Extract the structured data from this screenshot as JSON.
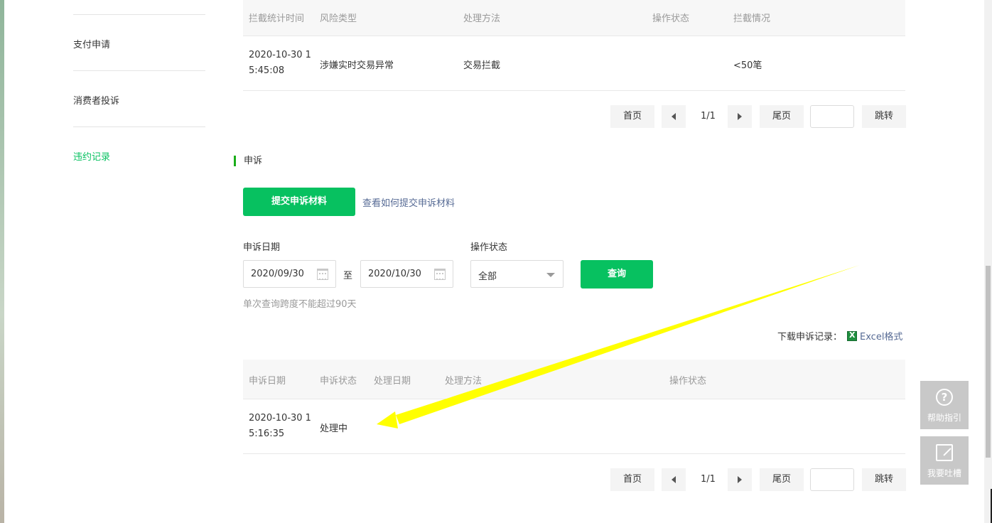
{
  "sidebar": {
    "items": [
      {
        "label": "支付申请"
      },
      {
        "label": "消费者投诉"
      },
      {
        "label": "违约记录",
        "active": true
      }
    ],
    "active_color": "#07c160"
  },
  "intercept_table": {
    "headers": [
      "拦截统计时间",
      "风险类型",
      "处理方法",
      "操作状态",
      "拦截情况"
    ],
    "rows": [
      {
        "time_line1": "2020-10-30 1",
        "time_line2": "5:45:08",
        "risk": "涉嫌实时交易异常",
        "method": "交易拦截",
        "status": "",
        "situation": "<50笔"
      }
    ]
  },
  "pager_top": {
    "first": "首页",
    "page": "1/1",
    "last": "尾页",
    "jump": "跳转",
    "input_value": ""
  },
  "appeal": {
    "section_title": "申诉",
    "submit_button": "提交申诉材料",
    "howto_link": "查看如何提交申诉材料",
    "date_label": "申诉日期",
    "date_from": "2020/09/30",
    "date_to_sep": "至",
    "date_to": "2020/10/30",
    "status_label": "操作状态",
    "status_value": "全部",
    "query_button": "查询",
    "hint": "单次查询跨度不能超过90天",
    "download_label": "下载申诉记录：",
    "excel_link": "Excel格式"
  },
  "appeal_table": {
    "headers": [
      "申诉日期",
      "申诉状态",
      "处理日期",
      "处理方法",
      "操作状态"
    ],
    "rows": [
      {
        "date_line1": "2020-10-30 1",
        "date_line2": "5:16:35",
        "status": "处理中",
        "process_date": "",
        "method": "",
        "op_status": ""
      }
    ]
  },
  "pager_bottom": {
    "first": "首页",
    "page": "1/1",
    "last": "尾页",
    "jump": "跳转",
    "input_value": ""
  },
  "float_buttons": {
    "help": "帮助指引",
    "feedback": "我要吐槽"
  },
  "annotation": {
    "arrow_color": "#ffff00"
  }
}
